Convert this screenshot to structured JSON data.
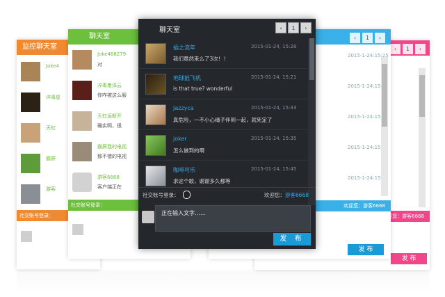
{
  "panel_orange": {
    "title": "监控聊天室",
    "rows": [
      {
        "name": "Joke4"
      },
      {
        "name": "淬毒星"
      },
      {
        "name": "天虹"
      },
      {
        "name": "霸屏"
      },
      {
        "name": "游客"
      }
    ],
    "footer": "社交账号登录：",
    "color": "#f08a30"
  },
  "panel_green": {
    "title": "聊天室",
    "rows": [
      {
        "name": "Joke468279",
        "text": "对"
      },
      {
        "name": "淬毒墨泽云",
        "text": "你咋被这么服"
      },
      {
        "name": "天虹运断开",
        "text": "确实啊，很"
      },
      {
        "name": "霸屏我的电视",
        "text": "那不错的电视"
      },
      {
        "name": "游客6668",
        "text": "客户端正在"
      }
    ],
    "footer": "社交账号登录：",
    "color": "#6dbf3e"
  },
  "panel_blue": {
    "times": [
      "2015-1-24:15:25",
      "2015-1-24:15:25",
      "2015-1-24:15:25",
      "2015-1-24:15:25",
      "2015-1-24:15:25"
    ],
    "footer": "欢迎您：游客6668",
    "send": "发 布",
    "page": "1",
    "color": "#3ab0e8"
  },
  "panel_pink": {
    "footer": "欢迎您：游客6668",
    "send": "发 布",
    "color": "#f0468a"
  },
  "main": {
    "title": "聊天室",
    "pager": {
      "prev": "‹",
      "page": "1",
      "next": "›"
    },
    "messages": [
      {
        "name": "插之流年",
        "time": "2015-01-24, 15:28",
        "text": "我们竟然来么了3次！！"
      },
      {
        "name": "地球抵飞机",
        "time": "2015-01-24, 15:21",
        "text": "is that true? wonderful"
      },
      {
        "name": "Jazzyca",
        "time": "2015-01-24, 15:33",
        "text": "真危险，一不小心绳子伴到一起，就死定了"
      },
      {
        "name": "joker",
        "time": "2015-01-24, 15:35",
        "text": "怎么做到的啊"
      },
      {
        "name": "咖啡可乐",
        "time": "2015-01-24, 15:45",
        "text": "求这个歌，谢谢多久都等"
      }
    ],
    "login_label": "社交账号登录：",
    "welcome_label": "欢迎您：",
    "username": "游客6668",
    "input_text": "正在输入文字……",
    "send": "发 布"
  }
}
